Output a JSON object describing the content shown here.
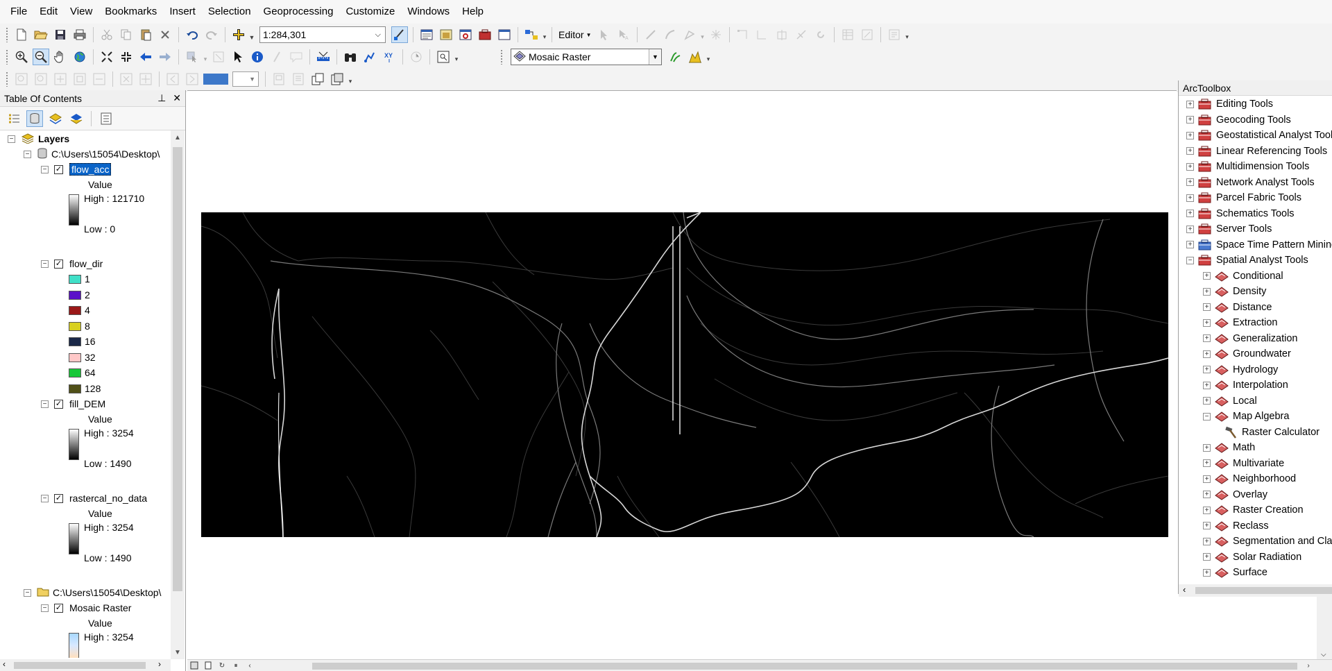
{
  "menu": [
    "File",
    "Edit",
    "View",
    "Bookmarks",
    "Insert",
    "Selection",
    "Geoprocessing",
    "Customize",
    "Windows",
    "Help"
  ],
  "toolbar": {
    "scale": "1:284,301",
    "editor_label": "Editor",
    "layer_combo": "Mosaic Raster"
  },
  "toc": {
    "title": "Table Of Contents",
    "root": "Layers",
    "group1": "C:\\Users\\15054\\Desktop\\",
    "group2": "C:\\Users\\15054\\Desktop\\",
    "layers": [
      {
        "name": "flow_acc",
        "value_label": "Value",
        "high": "High : 121710",
        "low": "Low : 0"
      },
      {
        "name": "flow_dir",
        "classes": [
          {
            "label": "1",
            "color": "#40e0c8"
          },
          {
            "label": "2",
            "color": "#5a10c8"
          },
          {
            "label": "4",
            "color": "#9a1818"
          },
          {
            "label": "8",
            "color": "#d8d020"
          },
          {
            "label": "16",
            "color": "#1a2848"
          },
          {
            "label": "32",
            "color": "#ffc8c8"
          },
          {
            "label": "64",
            "color": "#18c838"
          },
          {
            "label": "128",
            "color": "#505018"
          }
        ]
      },
      {
        "name": "fill_DEM",
        "value_label": "Value",
        "high": "High : 3254",
        "low": "Low : 1490"
      },
      {
        "name": "rastercal_no_data",
        "value_label": "Value",
        "high": "High : 3254",
        "low": "Low : 1490"
      },
      {
        "name": "Mosaic Raster",
        "value_label": "Value",
        "high": "High : 3254"
      }
    ]
  },
  "arctoolbox": {
    "title": "ArcToolbox",
    "items": [
      {
        "label": "Editing Tools",
        "level": 0,
        "state": "+",
        "icon": "toolbox-icon"
      },
      {
        "label": "Geocoding Tools",
        "level": 0,
        "state": "+",
        "icon": "toolbox-icon"
      },
      {
        "label": "Geostatistical Analyst Tools",
        "level": 0,
        "state": "+",
        "icon": "toolbox-icon"
      },
      {
        "label": "Linear Referencing Tools",
        "level": 0,
        "state": "+",
        "icon": "toolbox-icon"
      },
      {
        "label": "Multidimension Tools",
        "level": 0,
        "state": "+",
        "icon": "toolbox-icon"
      },
      {
        "label": "Network Analyst Tools",
        "level": 0,
        "state": "+",
        "icon": "toolbox-icon"
      },
      {
        "label": "Parcel Fabric Tools",
        "level": 0,
        "state": "+",
        "icon": "toolbox-icon"
      },
      {
        "label": "Schematics Tools",
        "level": 0,
        "state": "+",
        "icon": "toolbox-icon"
      },
      {
        "label": "Server Tools",
        "level": 0,
        "state": "+",
        "icon": "toolbox-icon"
      },
      {
        "label": "Space Time Pattern Mining Tools",
        "level": 0,
        "state": "+",
        "icon": "toolbox-blue-icon"
      },
      {
        "label": "Spatial Analyst Tools",
        "level": 0,
        "state": "-",
        "icon": "toolbox-icon"
      },
      {
        "label": "Conditional",
        "level": 1,
        "state": "+",
        "icon": "toolset-icon"
      },
      {
        "label": "Density",
        "level": 1,
        "state": "+",
        "icon": "toolset-icon"
      },
      {
        "label": "Distance",
        "level": 1,
        "state": "+",
        "icon": "toolset-icon"
      },
      {
        "label": "Extraction",
        "level": 1,
        "state": "+",
        "icon": "toolset-icon"
      },
      {
        "label": "Generalization",
        "level": 1,
        "state": "+",
        "icon": "toolset-icon"
      },
      {
        "label": "Groundwater",
        "level": 1,
        "state": "+",
        "icon": "toolset-icon"
      },
      {
        "label": "Hydrology",
        "level": 1,
        "state": "+",
        "icon": "toolset-icon"
      },
      {
        "label": "Interpolation",
        "level": 1,
        "state": "+",
        "icon": "toolset-icon"
      },
      {
        "label": "Local",
        "level": 1,
        "state": "+",
        "icon": "toolset-icon"
      },
      {
        "label": "Map Algebra",
        "level": 1,
        "state": "-",
        "icon": "toolset-icon"
      },
      {
        "label": "Raster Calculator",
        "level": 2,
        "state": "",
        "icon": "hammer-icon"
      },
      {
        "label": "Math",
        "level": 1,
        "state": "+",
        "icon": "toolset-icon"
      },
      {
        "label": "Multivariate",
        "level": 1,
        "state": "+",
        "icon": "toolset-icon"
      },
      {
        "label": "Neighborhood",
        "level": 1,
        "state": "+",
        "icon": "toolset-icon"
      },
      {
        "label": "Overlay",
        "level": 1,
        "state": "+",
        "icon": "toolset-icon"
      },
      {
        "label": "Raster Creation",
        "level": 1,
        "state": "+",
        "icon": "toolset-icon"
      },
      {
        "label": "Reclass",
        "level": 1,
        "state": "+",
        "icon": "toolset-icon"
      },
      {
        "label": "Segmentation and Classification",
        "level": 1,
        "state": "+",
        "icon": "toolset-icon"
      },
      {
        "label": "Solar Radiation",
        "level": 1,
        "state": "+",
        "icon": "toolset-icon"
      },
      {
        "label": "Surface",
        "level": 1,
        "state": "+",
        "icon": "toolset-icon"
      }
    ]
  }
}
